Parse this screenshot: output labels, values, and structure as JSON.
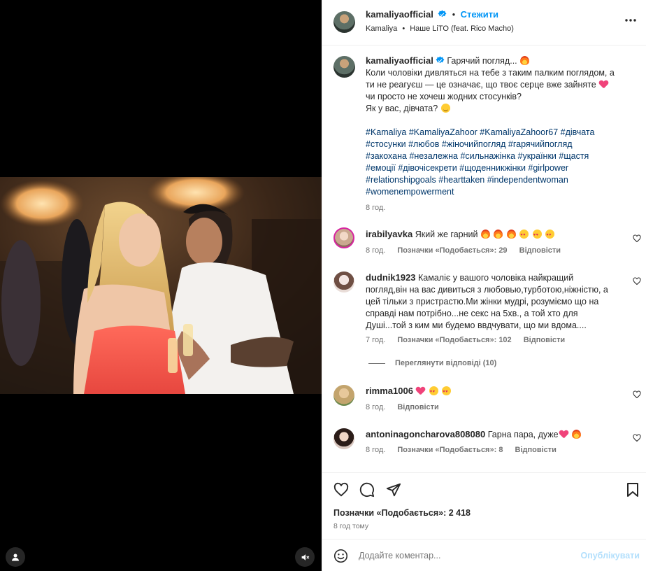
{
  "post": {
    "username": "kamaliyaofficial",
    "follow_label": "Стежити",
    "audio_artist": "Kamaliya",
    "audio_title": "Наше LiTO (feat. Rico Macho)",
    "more_icon": "more-horizontal-icon"
  },
  "caption": {
    "username": "kamaliyaofficial",
    "title": "Гарячий погляд...",
    "line1": "Коли чоловіки дивляться на тебе з таким палким поглядом, а",
    "line2": "ти не реагуєш — це означає, що твоє серце вже зайняте",
    "line3": "чи просто не хочеш жодних стосунків?",
    "line4": "Як у вас, дівчата?",
    "hashtags": [
      "#Kamaliya #KamaliyaZahoor #KamaliyaZahoor67 #дівчата",
      "#стосунки #любов #жіночийпогляд #гарячийпогляд",
      "#закохана #незалежна #сильнажінка #українки #щастя",
      "#емоції #дівочісекрети #щоденникжінки #girlpower",
      "#relationshipgoals #hearttaken #independentwoman",
      "#womenempowerment"
    ],
    "time": "8 год."
  },
  "comments": [
    {
      "username": "irabilyavka",
      "text": "Який же гарний",
      "time": "8 год.",
      "likes": "Позначки «Подобається»: 29",
      "reply": "Відповісти"
    },
    {
      "username": "dudnik1923",
      "lines": [
        "Камаліє у вашого чоловіка найкращий",
        "погляд,він на вас дивиться з любовью,турботою,ніжністю, а",
        "цей тільки з пристрастю.Ми жінки мудрі, розуміємо що на",
        "справді нам потрібно...не секс на 5хв., а той хто для",
        "Душі...той з ким ми будемо ввдчувати, що ми вдома...."
      ],
      "time": "7 год.",
      "likes": "Позначки «Подобається»: 102",
      "reply": "Відповісти",
      "view_replies": "Переглянути відповіді (10)"
    },
    {
      "username": "rimma1006",
      "text": "",
      "time": "8 год.",
      "reply": "Відповісти"
    },
    {
      "username": "antoninagoncharova808080",
      "text": "Гарна пара, дуже",
      "time": "8 год.",
      "likes": "Позначки «Подобається»: 8",
      "reply": "Відповісти"
    }
  ],
  "actions": {
    "likes": "Позначки «Подобається»: 2 418",
    "time": "8 год тому"
  },
  "add_comment": {
    "placeholder": "Додайте коментар...",
    "post_label": "Опублікувати"
  },
  "colors": {
    "accent": "#0095f6",
    "hashtag": "#00376b",
    "muted": "#737373"
  }
}
